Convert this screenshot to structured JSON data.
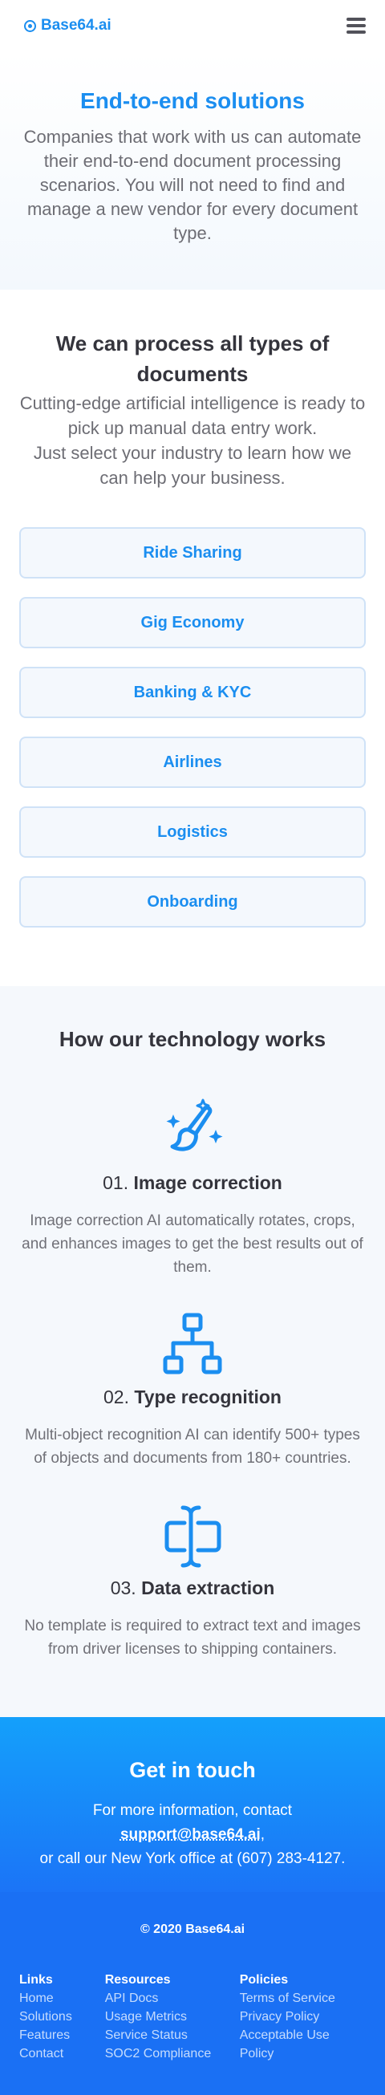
{
  "header": {
    "logo_text": "Base64.ai",
    "menu_icon": "hamburger-menu-icon"
  },
  "hero": {
    "title": "End-to-end solutions",
    "text": "Companies that work with us can automate their end-to-end document processing scenarios. You will not need to find and manage a new vendor for every document type."
  },
  "industries": {
    "title": "We can process all types of documents",
    "lead": "Cutting-edge artificial intelligence is ready to pick up manual data entry work.\nJust select your industry to learn how we can help your business.",
    "items": [
      "Ride Sharing",
      "Gig Economy",
      "Banking & KYC",
      "Airlines",
      "Logistics",
      "Onboarding"
    ]
  },
  "technology": {
    "title": "How our technology works",
    "steps": [
      {
        "number": "01.",
        "title": "Image correction",
        "text": "Image correction AI automatically rotates, crops, and enhances images to get the best results out of them.",
        "icon": "magic-brush-icon"
      },
      {
        "number": "02.",
        "title": "Type recognition",
        "text": "Multi-object recognition AI can identify 500+ types of objects and documents from 180+ countries.",
        "icon": "hierarchy-icon"
      },
      {
        "number": "03.",
        "title": "Data extraction",
        "text": "No template is required to extract text and images from driver licenses to shipping containers.",
        "icon": "text-cursor-field-icon"
      }
    ]
  },
  "contact": {
    "title": "Get in touch",
    "text_before": "For more information, contact ",
    "email": "support@base64.ai",
    "text_after": ",\nor call our New York office at (607) 283-4127."
  },
  "footer": {
    "copyright": "© 2020 Base64.ai",
    "columns": [
      {
        "heading": "Links",
        "items": [
          "Home",
          "Solutions",
          "Features",
          "Contact"
        ]
      },
      {
        "heading": "Resources",
        "items": [
          "API Docs",
          "Usage Metrics",
          "Service Status",
          "SOC2 Compliance"
        ]
      },
      {
        "heading": "Policies",
        "items": [
          "Terms of Service",
          "Privacy Policy",
          "Acceptable Use Policy"
        ]
      }
    ]
  },
  "colors": {
    "brand_blue": "#1b8ef0",
    "contact_gradient_top": "#14a0fb",
    "footer_blue": "#1a70f4"
  }
}
